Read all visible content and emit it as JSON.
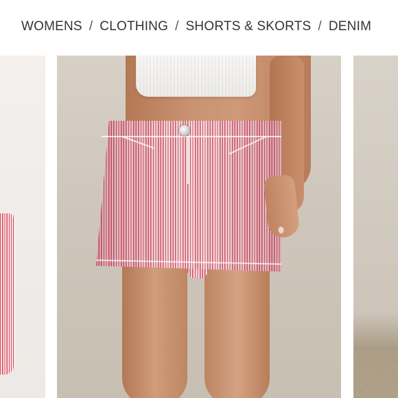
{
  "breadcrumb": {
    "items": [
      {
        "label": "WOMENS"
      },
      {
        "label": "CLOTHING"
      },
      {
        "label": "SHORTS & SKORTS"
      },
      {
        "label": "DENIM"
      }
    ],
    "separator": "/"
  },
  "product_images": [
    {
      "role": "previous",
      "icon": "product-photo"
    },
    {
      "role": "current",
      "icon": "product-photo"
    },
    {
      "role": "next",
      "icon": "product-photo"
    }
  ],
  "colors": {
    "background": "#ffffff",
    "text": "#333333",
    "stripe_red": "#cf4d5e",
    "stripe_white": "#f1d9dc"
  }
}
